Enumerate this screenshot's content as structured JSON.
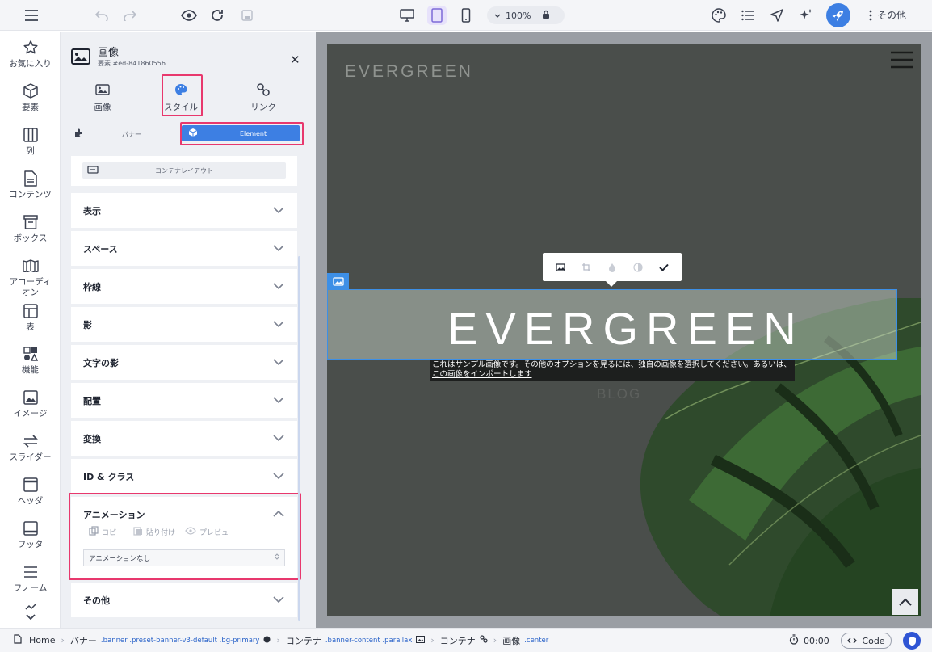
{
  "toolbar": {
    "zoom_value": "100%",
    "more_label": "その他"
  },
  "rail": {
    "items": [
      {
        "label": "お気に入り",
        "icon": "star-icon"
      },
      {
        "label": "要素",
        "icon": "cube-icon"
      },
      {
        "label": "列",
        "icon": "columns-icon"
      },
      {
        "label": "コンテンツ",
        "icon": "document-icon"
      },
      {
        "label": "ボックス",
        "icon": "box-icon"
      },
      {
        "label": "アコーディオン",
        "icon": "accordion-icon"
      },
      {
        "label": "表",
        "icon": "table-icon"
      },
      {
        "label": "機能",
        "icon": "shapes-icon"
      },
      {
        "label": "イメージ",
        "icon": "image-icon"
      },
      {
        "label": "スライダー",
        "icon": "swap-icon"
      },
      {
        "label": "ヘッダ",
        "icon": "header-icon"
      },
      {
        "label": "フッタ",
        "icon": "footer-icon"
      },
      {
        "label": "フォーム",
        "icon": "form-icon"
      }
    ]
  },
  "panel": {
    "title": "画像",
    "subtitle": "要素 #ed-841860556",
    "tabs": [
      {
        "label": "画像",
        "icon": "image-icon"
      },
      {
        "label": "スタイル",
        "icon": "palette-icon"
      },
      {
        "label": "リンク",
        "icon": "link-icon"
      }
    ],
    "segment_left": "バナー",
    "segment_right": "Element",
    "layout_button": "コンテナレイアウト",
    "accordions": [
      "表示",
      "スペース",
      "枠線",
      "影",
      "文字の影",
      "配置",
      "変換",
      "ID & クラス"
    ],
    "animation": {
      "title": "アニメーション",
      "copy_label": "コピー",
      "paste_label": "貼り付け",
      "preview_label": "プレビュー",
      "select_value": "アニメーションなし"
    },
    "other_label": "その他"
  },
  "canvas": {
    "site_logo": "EVERGREEN",
    "hero_text": "EVERGREEN",
    "blog_text": "BLOG",
    "notice_text": "これはサンプル画像です。その他のオプションを見るには、独自の画像を選択してください。",
    "notice_link": "あるいは、この画像をインポートします"
  },
  "statusbar": {
    "home": "Home",
    "crumbs": [
      {
        "name": "バナー",
        "classes": ".banner .preset-banner-v3-default .bg-primary"
      },
      {
        "name": "コンテナ",
        "classes": ".banner-content .parallax"
      },
      {
        "name": "コンテナ",
        "classes": ""
      },
      {
        "name": "画像",
        "classes": ".center"
      }
    ],
    "timer": "00:00",
    "code_label": "Code"
  },
  "colors": {
    "accent": "#3d7fe3",
    "highlight": "#e8386d"
  }
}
